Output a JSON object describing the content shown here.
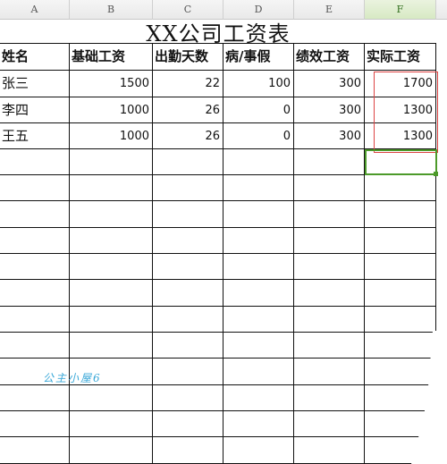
{
  "columns": [
    "A",
    "B",
    "C",
    "D",
    "E",
    "F"
  ],
  "title": "XX公司工资表",
  "headers": [
    "姓名",
    "基础工资",
    "出勤天数",
    "病/事假",
    "绩效工资",
    "实际工资"
  ],
  "rows": [
    [
      "张三",
      "1500",
      "22",
      "100",
      "300",
      "1700"
    ],
    [
      "李四",
      "1000",
      "26",
      "0",
      "300",
      "1300"
    ],
    [
      "王五",
      "1000",
      "26",
      "0",
      "300",
      "1300"
    ]
  ],
  "watermark": "公主小屋6",
  "selected_column": "F"
}
